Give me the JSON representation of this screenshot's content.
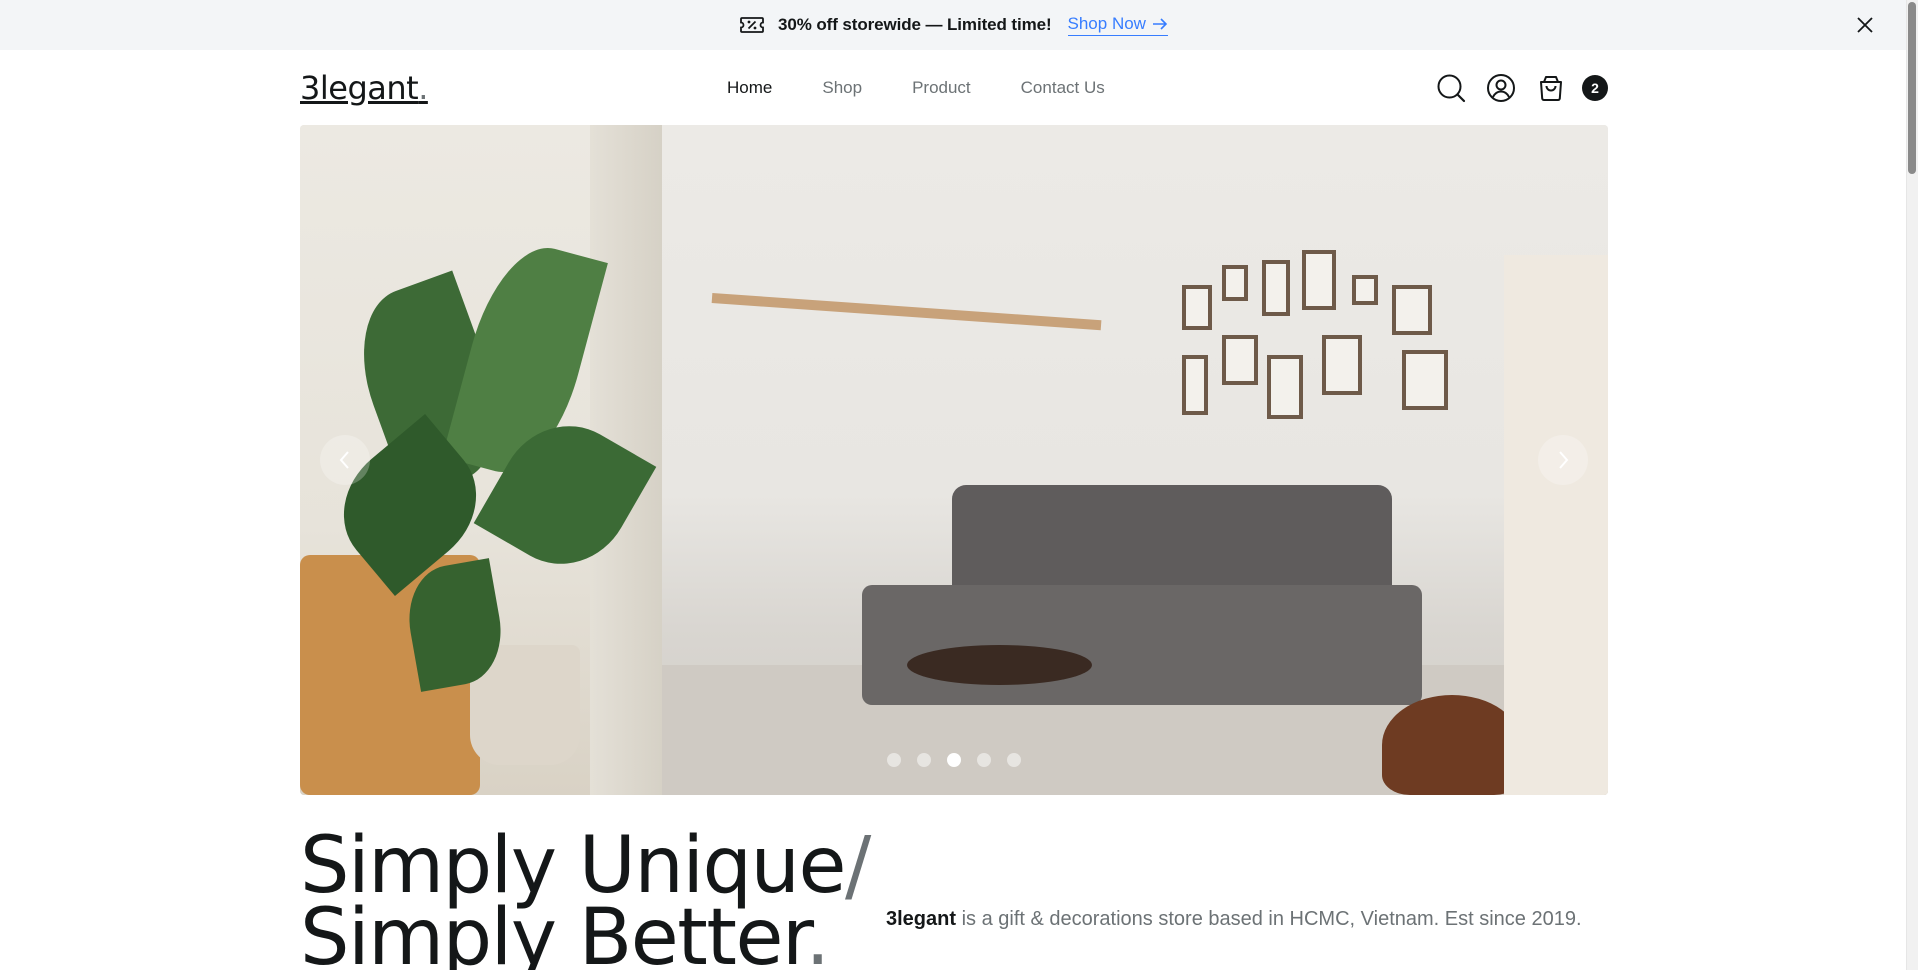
{
  "announcement": {
    "text": "30% off storewide — Limited time!",
    "link_label": "Shop Now",
    "icon": "ticket-percent-icon"
  },
  "header": {
    "logo": "3legant",
    "logo_dot": ".",
    "nav": [
      {
        "label": "Home",
        "active": true
      },
      {
        "label": "Shop",
        "active": false
      },
      {
        "label": "Product",
        "active": false
      },
      {
        "label": "Contact Us",
        "active": false
      }
    ],
    "icons": [
      "search-icon",
      "user-icon",
      "shopping-bag-icon"
    ],
    "cart_count": "2"
  },
  "hero": {
    "slides_total": 5,
    "active_slide": 3
  },
  "intro": {
    "headline_line1": "Simply Unique",
    "slash": "/",
    "headline_line2": "Simply Better",
    "period": ".",
    "brand": "3legant",
    "tagline_rest": " is a gift & decorations store based in HCMC, Vietnam. Est since 2019."
  },
  "colors": {
    "accent_link": "#377dff",
    "text_dark": "#141718",
    "text_muted": "#6c7275",
    "topbar_bg": "#f3f5f7"
  }
}
